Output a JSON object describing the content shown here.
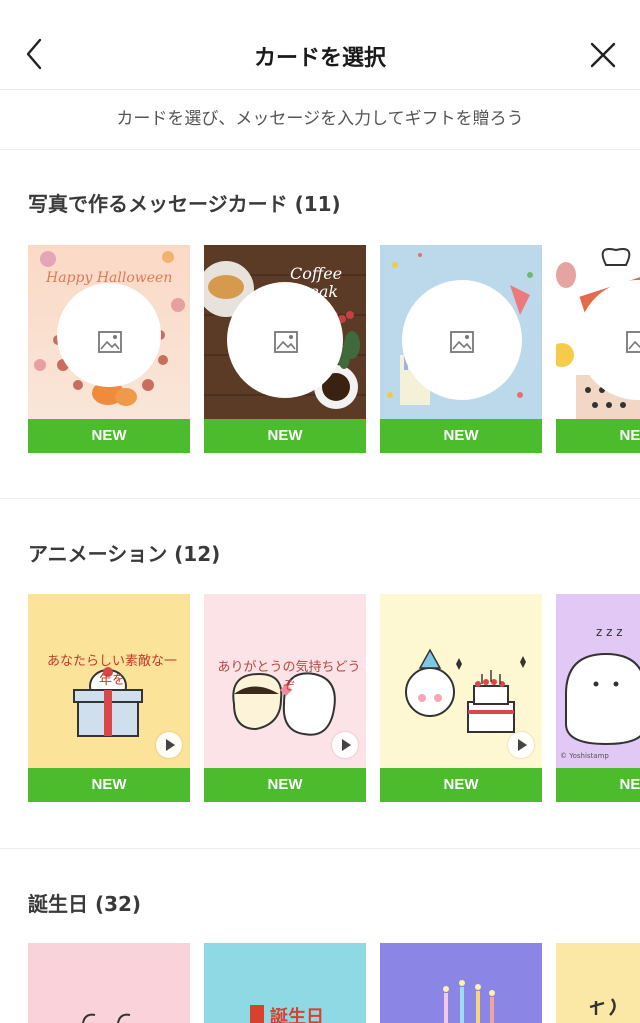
{
  "header": {
    "title": "カードを選択"
  },
  "subtitle": "カードを選び、メッセージを入力してギフトを贈ろう",
  "sections": [
    {
      "title": "写真で作るメッセージカード (11)",
      "cards": [
        {
          "badge": "NEW",
          "art_text": "Happy Halloween"
        },
        {
          "badge": "NEW",
          "art_text": "Coffee Break"
        },
        {
          "badge": "NEW"
        },
        {
          "badge": "NEW"
        }
      ]
    },
    {
      "title": "アニメーション (12)",
      "cards": [
        {
          "badge": "NEW",
          "art_text": "あなたらしい素敵な一年を"
        },
        {
          "badge": "NEW",
          "art_text": "ありがとうの気持ちどうぞ"
        },
        {
          "badge": "NEW"
        },
        {
          "badge": "NEW",
          "art_text": "© Yoshistamp"
        }
      ]
    },
    {
      "title": "誕生日 (32)",
      "cards": [
        {},
        {
          "art_text": "誕生日"
        },
        {},
        {}
      ]
    }
  ],
  "icons": {
    "back": "chevron-left-icon",
    "close": "close-icon",
    "photo": "image-placeholder-icon",
    "play": "play-icon"
  },
  "colors": {
    "new_badge": "#4cbb2c"
  }
}
